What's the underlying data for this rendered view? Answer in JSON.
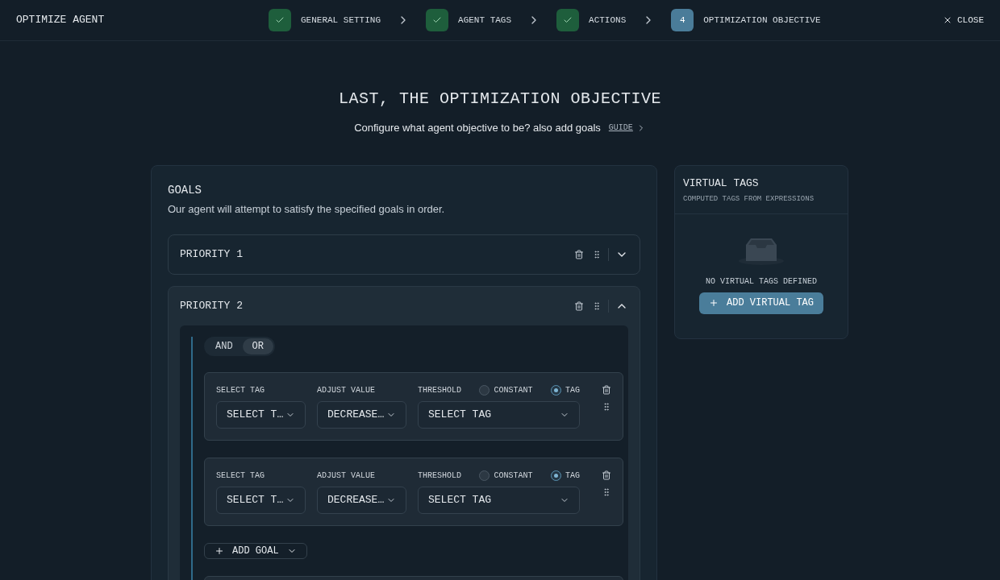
{
  "header": {
    "title": "OPTIMIZE AGENT",
    "close": "CLOSE",
    "steps": [
      {
        "kind": "done",
        "label": "GENERAL SETTING"
      },
      {
        "kind": "done",
        "label": "AGENT TAGS"
      },
      {
        "kind": "done",
        "label": "ACTIONS"
      },
      {
        "kind": "current",
        "number": "4",
        "label": "OPTIMIZATION OBJECTIVE"
      }
    ]
  },
  "intro": {
    "heading": "LAST, THE OPTIMIZATION OBJECTIVE",
    "text": "Configure what agent objective to be? also add goals",
    "link": "GUIDE"
  },
  "goals": {
    "title": "GOALS",
    "description": "Our agent will attempt to satisfy the specified goals in order.",
    "priorities": [
      {
        "label": "PRIORITY 1",
        "expanded": false
      },
      {
        "label": "PRIORITY 2",
        "expanded": true,
        "logic": [
          {
            "label": "AND",
            "selected": false
          },
          {
            "label": "OR",
            "selected": true
          }
        ],
        "conditions": [
          {
            "tag_label": "SELECT TAG",
            "tag_value": "SELECT T…",
            "adjust_label": "ADJUST VALUE",
            "adjust_value": "DECREASE…",
            "threshold_label": "THRESHOLD",
            "threshold_value": "SELECT TAG",
            "options": [
              {
                "label": "CONSTANT",
                "selected": false
              },
              {
                "label": "TAG",
                "selected": true
              }
            ]
          },
          {
            "tag_label": "SELECT TAG",
            "tag_value": "SELECT T…",
            "adjust_label": "ADJUST VALUE",
            "adjust_value": "DECREASE…",
            "threshold_label": "THRESHOLD",
            "threshold_value": "SELECT TAG",
            "options": [
              {
                "label": "CONSTANT",
                "selected": false
              },
              {
                "label": "TAG",
                "selected": true
              }
            ]
          }
        ],
        "add_goal": "ADD GOAL"
      }
    ]
  },
  "virtual_tags": {
    "title": "VIRTUAL TAGS",
    "subtitle": "COMPUTED TAGS FROM EXPRESSIONS",
    "empty_text": "NO VIRTUAL TAGS DEFINED",
    "add_button": "ADD VIRTUAL TAG"
  }
}
